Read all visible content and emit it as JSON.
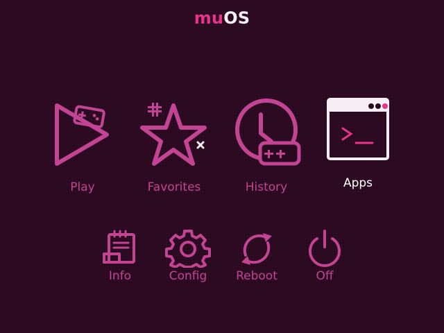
{
  "brand": {
    "part1": "mu",
    "part2": "OS"
  },
  "colors": {
    "background": "#2a0820",
    "accent": "#c24493",
    "brand_accent": "#e8338b",
    "selected": "#ffffff"
  },
  "main_menu": [
    {
      "label": "Play",
      "icon": "play-icon",
      "selected": false
    },
    {
      "label": "Favorites",
      "icon": "star-icon",
      "selected": false
    },
    {
      "label": "History",
      "icon": "clock-icon",
      "selected": false
    },
    {
      "label": "Apps",
      "icon": "terminal-window-icon",
      "selected": true
    }
  ],
  "sub_menu": [
    {
      "label": "Info",
      "icon": "notepad-icon"
    },
    {
      "label": "Config",
      "icon": "gear-icon"
    },
    {
      "label": "Reboot",
      "icon": "refresh-icon"
    },
    {
      "label": "Off",
      "icon": "power-icon"
    }
  ]
}
